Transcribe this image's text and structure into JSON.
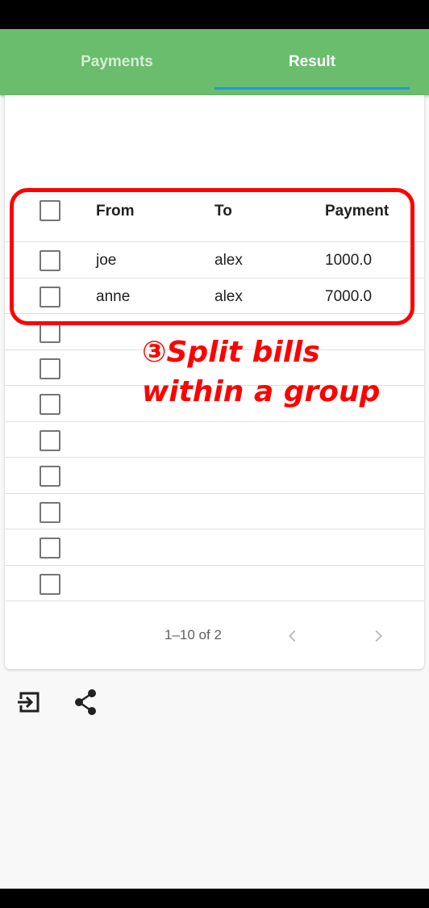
{
  "tabs": [
    {
      "label": "Payments",
      "active": false
    },
    {
      "label": "Result",
      "active": true
    }
  ],
  "accent_color": "#69bd6c",
  "indicator_color": "#2196f3",
  "table": {
    "columns": [
      "From",
      "To",
      "Payment"
    ],
    "rows": [
      {
        "from": "joe",
        "to": "alex",
        "payment": "1000.0"
      },
      {
        "from": "anne",
        "to": "alex",
        "payment": "7000.0"
      }
    ],
    "empty_rows": 8
  },
  "pagination": {
    "text": "1–10 of 2",
    "prev_icon": "chevron-left-icon",
    "next_icon": "chevron-right-icon"
  },
  "annotation": {
    "line1": "③Split bills",
    "line2": "within a group",
    "color": "#ff0000"
  },
  "actions": [
    {
      "icon": "exit-to-app-icon"
    },
    {
      "icon": "share-icon"
    }
  ]
}
